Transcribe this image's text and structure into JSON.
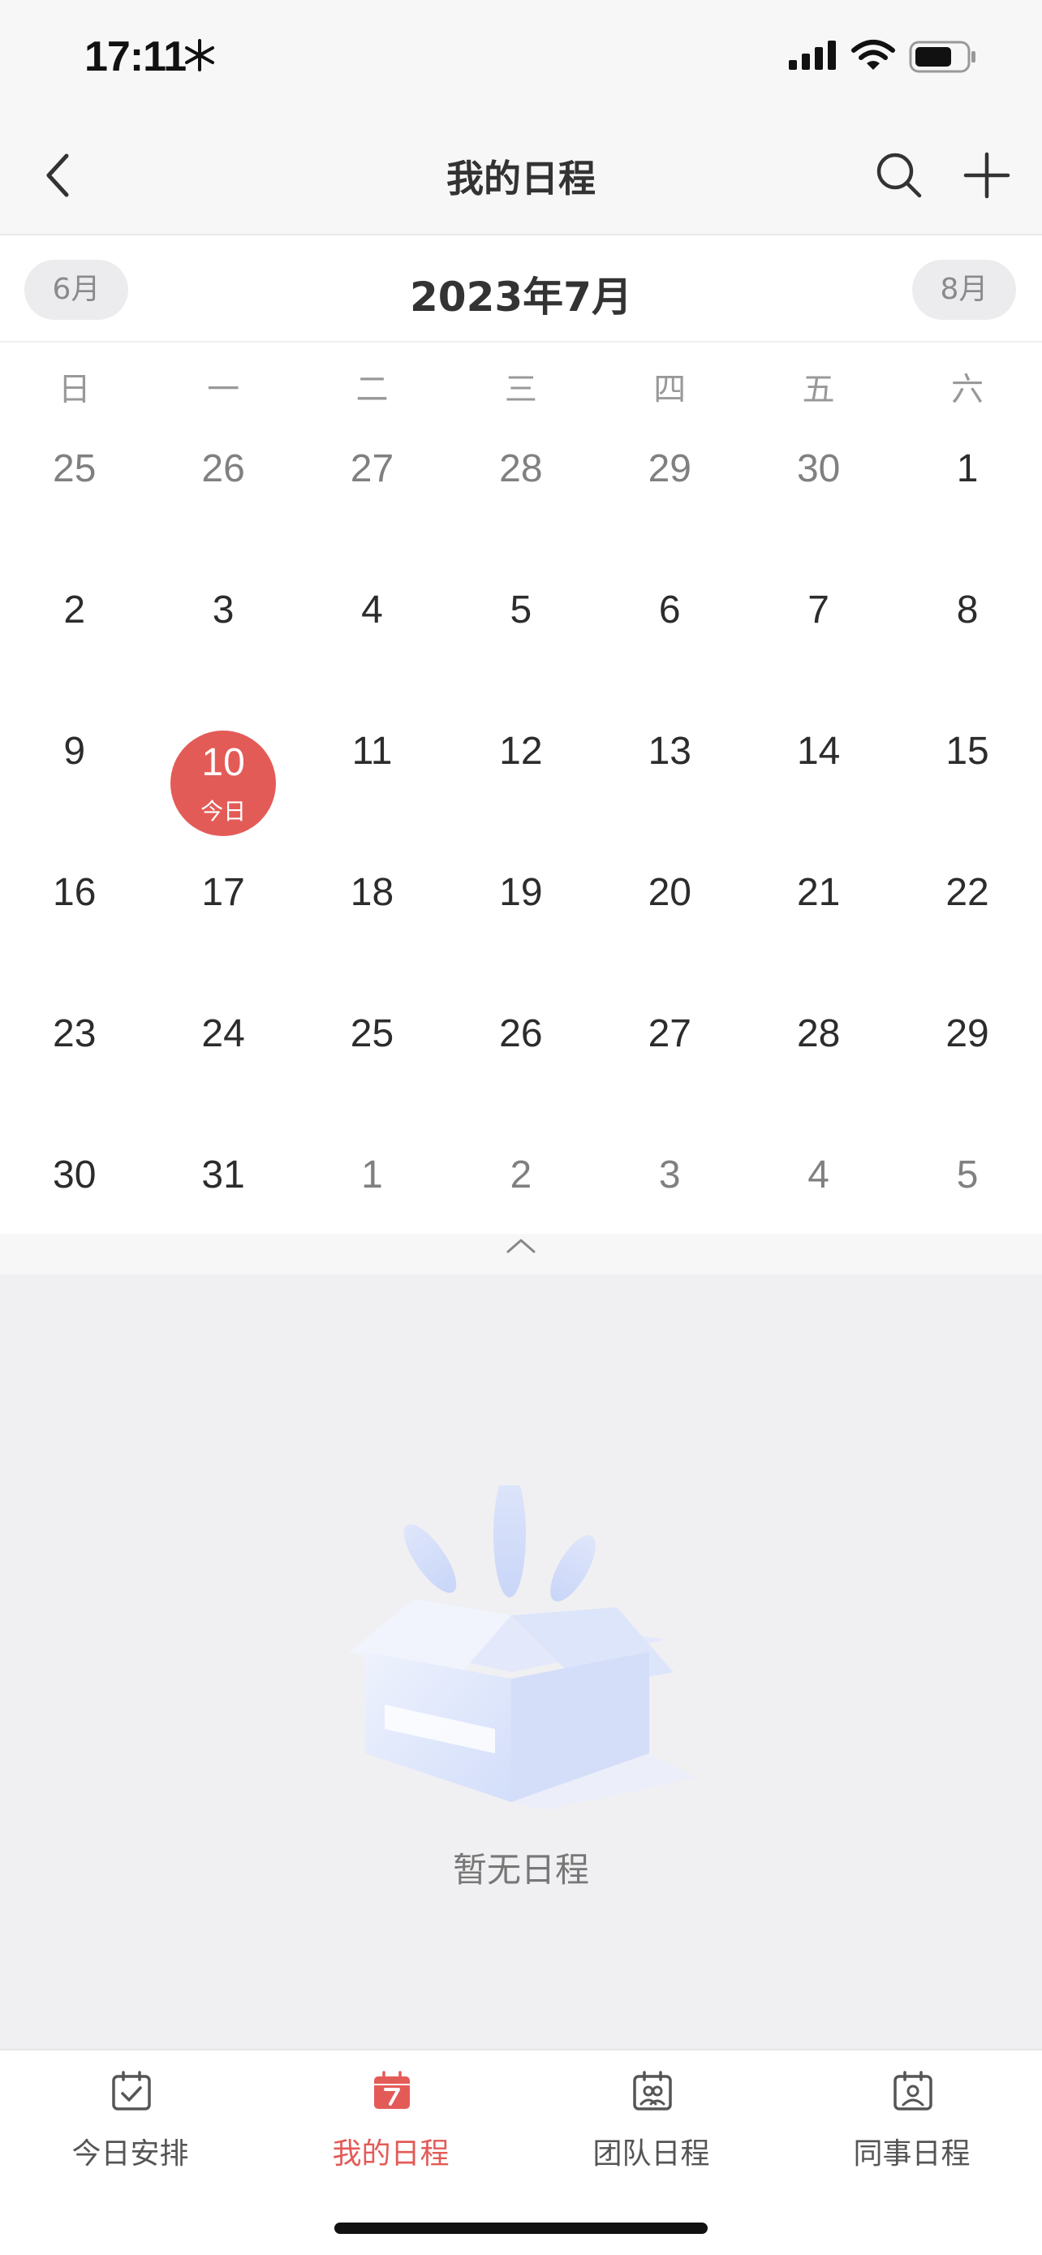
{
  "status_bar": {
    "time": "17:11"
  },
  "nav": {
    "title": "我的日程"
  },
  "calendar": {
    "prev_month": "6月",
    "next_month": "8月",
    "title": "2023年7月",
    "weekdays": [
      "日",
      "一",
      "二",
      "三",
      "四",
      "五",
      "六"
    ],
    "today_tag": "今日",
    "weeks": [
      [
        {
          "d": "25",
          "other": true
        },
        {
          "d": "26",
          "other": true
        },
        {
          "d": "27",
          "other": true
        },
        {
          "d": "28",
          "other": true
        },
        {
          "d": "29",
          "other": true
        },
        {
          "d": "30",
          "other": true
        },
        {
          "d": "1"
        }
      ],
      [
        {
          "d": "2"
        },
        {
          "d": "3"
        },
        {
          "d": "4"
        },
        {
          "d": "5"
        },
        {
          "d": "6"
        },
        {
          "d": "7"
        },
        {
          "d": "8"
        }
      ],
      [
        {
          "d": "9"
        },
        {
          "d": "10",
          "today": true
        },
        {
          "d": "11"
        },
        {
          "d": "12"
        },
        {
          "d": "13"
        },
        {
          "d": "14"
        },
        {
          "d": "15"
        }
      ],
      [
        {
          "d": "16"
        },
        {
          "d": "17"
        },
        {
          "d": "18"
        },
        {
          "d": "19"
        },
        {
          "d": "20"
        },
        {
          "d": "21"
        },
        {
          "d": "22"
        }
      ],
      [
        {
          "d": "23"
        },
        {
          "d": "24"
        },
        {
          "d": "25"
        },
        {
          "d": "26"
        },
        {
          "d": "27"
        },
        {
          "d": "28"
        },
        {
          "d": "29"
        }
      ],
      [
        {
          "d": "30"
        },
        {
          "d": "31"
        },
        {
          "d": "1",
          "other": true
        },
        {
          "d": "2",
          "other": true
        },
        {
          "d": "3",
          "other": true
        },
        {
          "d": "4",
          "other": true
        },
        {
          "d": "5",
          "other": true
        }
      ]
    ]
  },
  "empty_state": {
    "text": "暂无日程"
  },
  "tabs": [
    {
      "label": "今日安排",
      "icon": "calendar-check-icon",
      "active": false
    },
    {
      "label": "我的日程",
      "icon": "calendar-7-icon",
      "active": true
    },
    {
      "label": "团队日程",
      "icon": "calendar-team-icon",
      "active": false
    },
    {
      "label": "同事日程",
      "icon": "calendar-person-icon",
      "active": false
    }
  ],
  "colors": {
    "accent": "#e35b57",
    "text": "#2c2c2c",
    "muted": "#808080"
  }
}
